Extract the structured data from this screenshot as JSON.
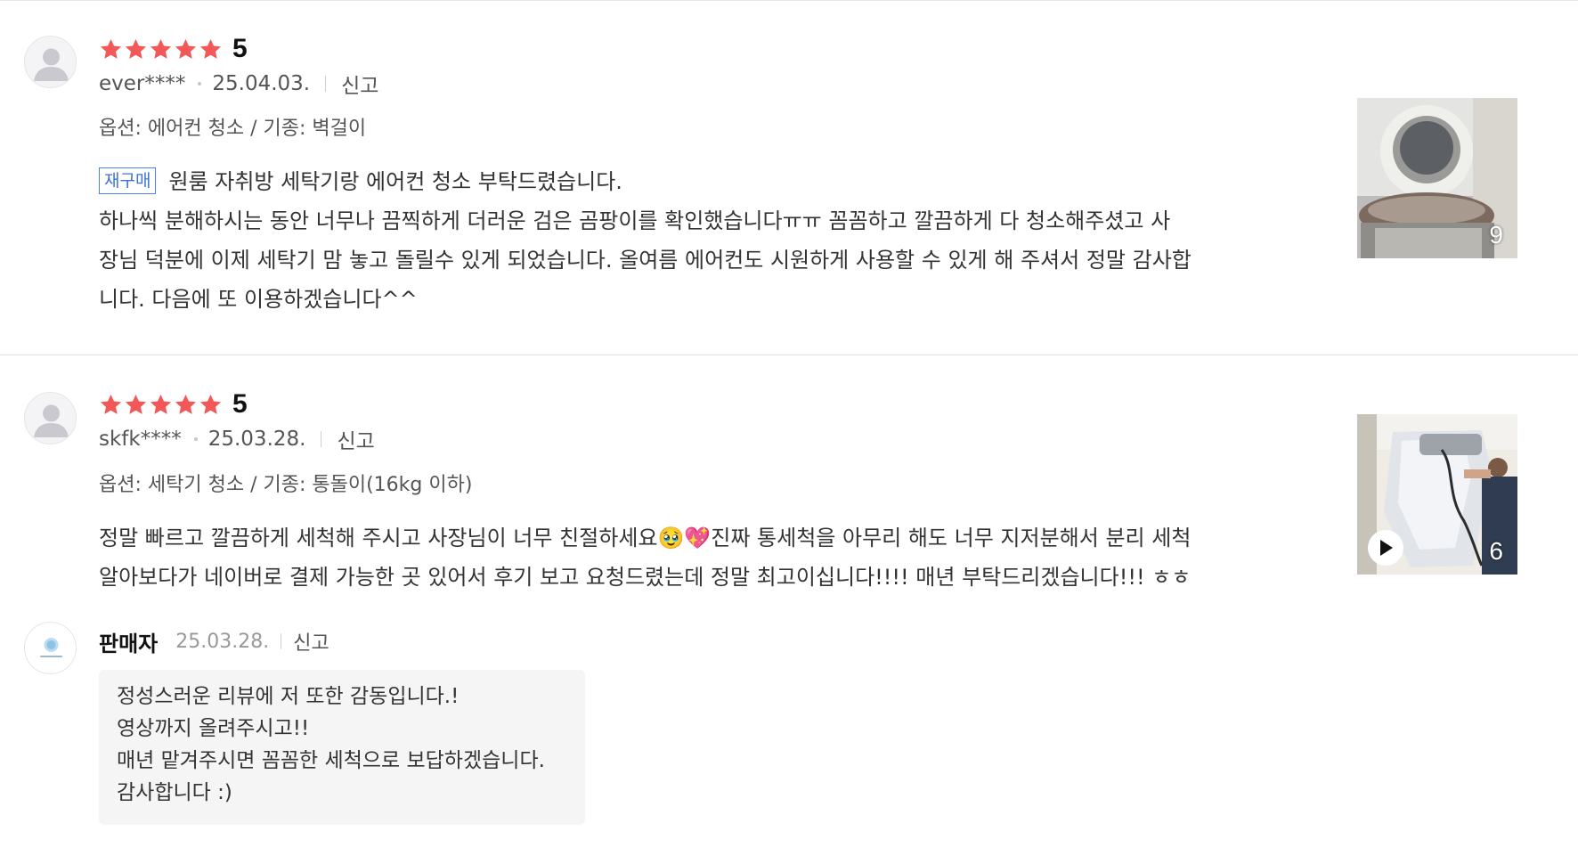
{
  "reviews": [
    {
      "score": "5",
      "stars_filled": 5,
      "user": "ever****",
      "date": "25.04.03.",
      "report_label": "신고",
      "option": "옵션: 에어컨 청소 / 기종: 벽걸이",
      "badge": "재구매",
      "lines": [
        "원룸 자취방 세탁기랑 에어컨 청소 부탁드렸습니다.",
        "하나씩 분해하시는 동안 너무나 끔찍하게 더러운 검은 곰팡이를 확인했습니다ㅠㅠ  꼼꼼하고 깔끔하게 다 청소해주셨고 사",
        "장님 덕분에 이제 세탁기 맘 놓고 돌릴수 있게 되었습니다. 올여름 에어컨도 시원하게 사용할 수 있게 해 주셔서 정말 감사합",
        "니다. 다음에 또 이용하겠습니다^^"
      ],
      "photo_count": "9",
      "media_type": "photo"
    },
    {
      "score": "5",
      "stars_filled": 5,
      "user": "skfk****",
      "date": "25.03.28.",
      "report_label": "신고",
      "option": "옵션: 세탁기 청소 / 기종: 통돌이(16kg 이하)",
      "lines": [
        "정말 빠르고 깔끔하게 세척해 주시고 사장님이 너무 친절하세요🥹💖진짜 통세척을 아무리 해도 너무 지저분해서 분리 세척",
        "알아보다가 네이버로 결제 가능한 곳 있어서 후기 보고 요청드렸는데 정말 최고이십니다!!!! 매년 부탁드리겠습니다!!! ㅎㅎ"
      ],
      "photo_count": "6",
      "media_type": "video"
    }
  ],
  "seller_reply": {
    "name": "판매자",
    "date": "25.03.28.",
    "report_label": "신고",
    "lines": [
      "정성스러운 리뷰에 저 또한 감동입니다.!",
      "영상까지 올려주시고!!",
      "매년 맡겨주시면 꼼꼼한 세척으로 보답하겠습니다.",
      "감사합니다 :)"
    ]
  },
  "colors": {
    "star": "#f25858",
    "badge": "#3d72d8",
    "reply_bg": "#f5f5f5"
  }
}
